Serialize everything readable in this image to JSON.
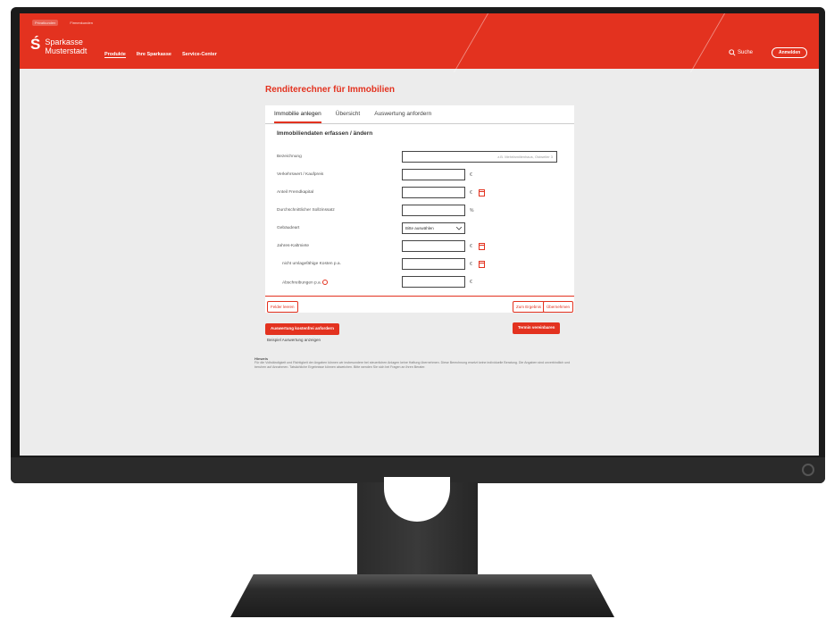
{
  "header": {
    "meta_links": [
      "Privatkunden",
      "Firmenkunden"
    ],
    "logo_symbol": "Ś",
    "logo_line1": "Sparkasse",
    "logo_line2": "Musterstadt",
    "nav": [
      "Produkte",
      "Ihre Sparkasse",
      "Service-Center"
    ],
    "search_label": "Suche",
    "login_label": "Anmelden"
  },
  "main": {
    "title": "Renditerechner für Immobilien",
    "tabs": [
      "Immobilie anlegen",
      "Übersicht",
      "Auswertung anfordern"
    ],
    "form_title": "Immobiliendaten erfassen / ändern",
    "fields": {
      "bezeichnung": {
        "label": "Bezeichnung",
        "placeholder": "z.B. Mehrfamilienhaus, Ostweiler 3"
      },
      "verkehrswert": {
        "label": "Verkehrswert / Kaufpreis",
        "unit": "€"
      },
      "fremdkapital": {
        "label": "Anteil Fremdkapital",
        "unit": "€"
      },
      "sollzins": {
        "label": "Durchschnittlicher Sollzinssatz",
        "unit": "%"
      },
      "gebaeudeart": {
        "label": "Gebäudeart",
        "value": "Bitte auswählen"
      },
      "kaltmiete": {
        "label": "Jahres-Kaltmiete",
        "unit": "€"
      },
      "kosten": {
        "label": "nicht umlagefähige Kosten p.a.",
        "unit": "€"
      },
      "abschreibungen": {
        "label": "Abschreibungen p.a.",
        "unit": "€"
      }
    },
    "buttons": {
      "clear": "Felder leeren",
      "back": "Zum Ergebnis",
      "apply": "Übernehmen",
      "request": "Auswertung kostenfrei anfordern",
      "appointment": "Termin vereinbaren"
    },
    "example_link": "Beispiel Auswertung anzeigen",
    "note_title": "Hinweis",
    "note_text": "Für die Vollständigkeit und Richtigkeit der Angaben können wir insbesondere bei steuerlichen Anlagen keine Haftung übernehmen. Diese Berechnung ersetzt keine individuelle Beratung. Die Angaben sind unverbindlich und beruhen auf Annahmen. Tatsächliche Ergebnisse können abweichen. Bitte wenden Sie sich bei Fragen an Ihren Berater."
  }
}
